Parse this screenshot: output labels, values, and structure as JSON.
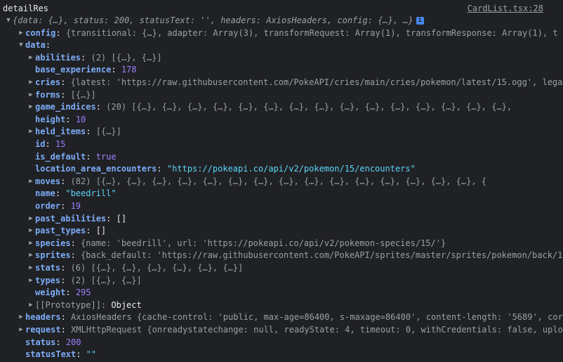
{
  "console": {
    "variable_name": "detailRes",
    "source_link": "CardList.tsx:28",
    "info_icon": "i",
    "root_preview": "{data: {…}, status: 200, statusText: '', headers: AxiosHeaders, config: {…}, …}",
    "rows": [
      {
        "depth": 1,
        "tri": "right",
        "key": "config",
        "value": "{transitional: {…}, adapter: Array(3), transformRequest: Array(1), transformResponse: Array(1), t",
        "vclass": "preview"
      },
      {
        "depth": 1,
        "tri": "down",
        "key": "data",
        "value": "",
        "vclass": "plain"
      },
      {
        "depth": 2,
        "tri": "right",
        "key": "abilities",
        "value": "(2) [{…}, {…}]",
        "vclass": "preview"
      },
      {
        "depth": 2,
        "tri": "none",
        "key": "base_experience",
        "value": "178",
        "vclass": "num"
      },
      {
        "depth": 2,
        "tri": "right",
        "key": "cries",
        "value": "{latest: 'https://raw.githubusercontent.com/PokeAPI/cries/main/cries/pokemon/latest/15.ogg', lega",
        "vclass": "preview"
      },
      {
        "depth": 2,
        "tri": "right",
        "key": "forms",
        "value": "[{…}]",
        "vclass": "preview"
      },
      {
        "depth": 2,
        "tri": "right",
        "key": "game_indices",
        "value": "(20) [{…}, {…}, {…}, {…}, {…}, {…}, {…}, {…}, {…}, {…}, {…}, {…}, {…}, {…}, {…},",
        "vclass": "preview"
      },
      {
        "depth": 2,
        "tri": "none",
        "key": "height",
        "value": "10",
        "vclass": "num"
      },
      {
        "depth": 2,
        "tri": "right",
        "key": "held_items",
        "value": "[{…}]",
        "vclass": "preview"
      },
      {
        "depth": 2,
        "tri": "none",
        "key": "id",
        "value": "15",
        "vclass": "num"
      },
      {
        "depth": 2,
        "tri": "none",
        "key": "is_default",
        "value": "true",
        "vclass": "kw"
      },
      {
        "depth": 2,
        "tri": "none",
        "key": "location_area_encounters",
        "value": "\"https://pokeapi.co/api/v2/pokemon/15/encounters\"",
        "vclass": "str"
      },
      {
        "depth": 2,
        "tri": "right",
        "key": "moves",
        "value": "(82) [{…}, {…}, {…}, {…}, {…}, {…}, {…}, {…}, {…}, {…}, {…}, {…}, {…}, {…}, {…}, {",
        "vclass": "preview"
      },
      {
        "depth": 2,
        "tri": "none",
        "key": "name",
        "value": "\"beedrill\"",
        "vclass": "str"
      },
      {
        "depth": 2,
        "tri": "none",
        "key": "order",
        "value": "19",
        "vclass": "num"
      },
      {
        "depth": 2,
        "tri": "right",
        "key": "past_abilities",
        "value": "[]",
        "vclass": "plain"
      },
      {
        "depth": 2,
        "tri": "right",
        "key": "past_types",
        "value": "[]",
        "vclass": "plain"
      },
      {
        "depth": 2,
        "tri": "right",
        "key": "species",
        "value": "{name: 'beedrill', url: 'https://pokeapi.co/api/v2/pokemon-species/15/'}",
        "vclass": "preview"
      },
      {
        "depth": 2,
        "tri": "right",
        "key": "sprites",
        "value": "{back_default: 'https://raw.githubusercontent.com/PokeAPI/sprites/master/sprites/pokemon/back/1",
        "vclass": "preview"
      },
      {
        "depth": 2,
        "tri": "right",
        "key": "stats",
        "value": "(6) [{…}, {…}, {…}, {…}, {…}, {…}]",
        "vclass": "preview"
      },
      {
        "depth": 2,
        "tri": "right",
        "key": "types",
        "value": "(2) [{…}, {…}]",
        "vclass": "preview"
      },
      {
        "depth": 2,
        "tri": "none",
        "key": "weight",
        "value": "295",
        "vclass": "num"
      },
      {
        "depth": 2,
        "tri": "right",
        "key": "[[Prototype]]",
        "value": "Object",
        "vclass": "plain",
        "dimkey": true
      },
      {
        "depth": 1,
        "tri": "right",
        "key": "headers",
        "value": "AxiosHeaders {cache-control: 'public, max-age=86400, s-maxage=86400', content-length: '5689', cor",
        "vclass": "preview"
      },
      {
        "depth": 1,
        "tri": "right",
        "key": "request",
        "value": "XMLHttpRequest {onreadystatechange: null, readyState: 4, timeout: 0, withCredentials: false, uplo",
        "vclass": "preview"
      },
      {
        "depth": 1,
        "tri": "none",
        "key": "status",
        "value": "200",
        "vclass": "num"
      },
      {
        "depth": 1,
        "tri": "none",
        "key": "statusText",
        "value": "\"\"",
        "vclass": "str"
      }
    ]
  },
  "colors": {
    "background": "#202124",
    "key": "#7cacf8",
    "string": "#5cd5fb",
    "number": "#9980ff",
    "preview": "#9aa0a6"
  }
}
